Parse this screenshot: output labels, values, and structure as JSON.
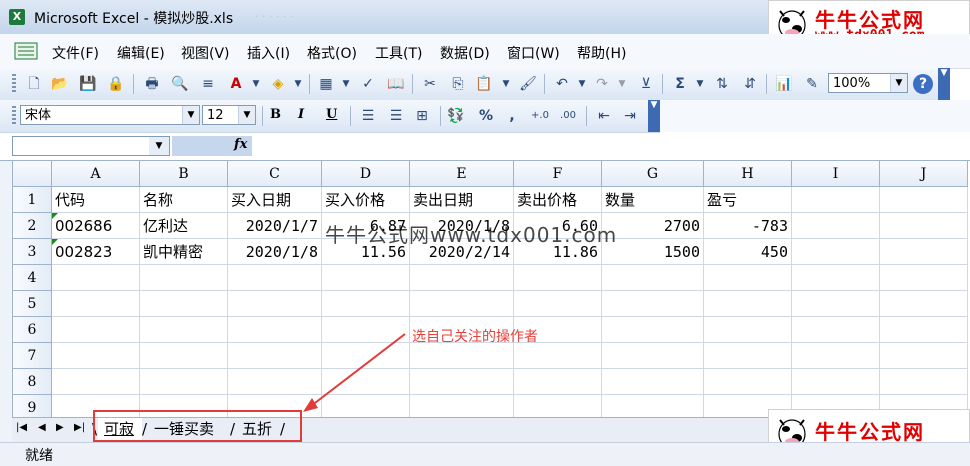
{
  "window": {
    "app_title": "Microsoft Excel - 模拟炒股.xls"
  },
  "watermark": {
    "name": "牛牛公式网",
    "url": "www.tdx001.com"
  },
  "menu": [
    "文件(F)",
    "编辑(E)",
    "视图(V)",
    "插入(I)",
    "格式(O)",
    "工具(T)",
    "数据(D)",
    "窗口(W)",
    "帮助(H)"
  ],
  "toolbar": {
    "zoom": "100%"
  },
  "format_toolbar": {
    "font": "宋体",
    "size": "12",
    "bold": "B",
    "italic": "I",
    "underline": "U",
    "percent": "%",
    "comma": ","
  },
  "formula_bar": {
    "fx": "fx"
  },
  "columns": [
    "A",
    "B",
    "C",
    "D",
    "E",
    "F",
    "G",
    "H",
    "I",
    "J"
  ],
  "rows": [
    "1",
    "2",
    "3",
    "4",
    "5",
    "6",
    "7",
    "8",
    "9"
  ],
  "sheet": {
    "header": [
      "代码",
      "名称",
      "买入日期",
      "买入价格",
      "卖出日期",
      "卖出价格",
      "数量",
      "盈亏"
    ],
    "r2": [
      "002686",
      "亿利达",
      "2020/1/7",
      "6.87",
      "2020/1/8",
      "6.60",
      "2700",
      "-783"
    ],
    "r3": [
      "002823",
      "凯中精密",
      "2020/1/8",
      "11.56",
      "2020/2/14",
      "11.86",
      "1500",
      "450"
    ]
  },
  "overlay_text": "牛牛公式网www.tdx001.com",
  "annotation": "选自己关注的操作者",
  "tabs": [
    "可寂",
    "一锤买卖",
    "五折"
  ],
  "status": "就绪"
}
